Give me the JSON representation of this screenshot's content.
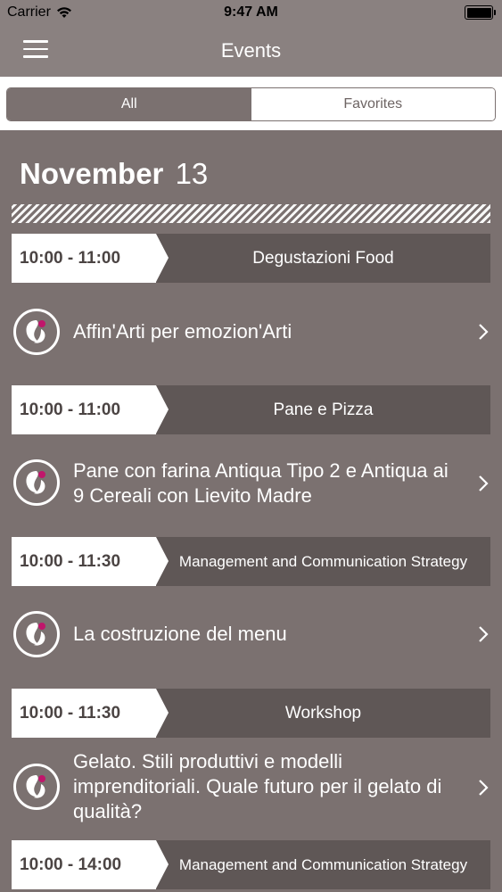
{
  "status_bar": {
    "carrier": "Carrier",
    "time": "9:47 AM"
  },
  "nav": {
    "title": "Events"
  },
  "segments": {
    "all": "All",
    "favorites": "Favorites",
    "selected": "All"
  },
  "date": {
    "month": "November",
    "day": "13"
  },
  "sessions": [
    {
      "time": "10:00 - 11:00",
      "title": "Degustazioni Food"
    },
    {
      "time": "10:00 - 11:00",
      "title": "Pane e Pizza"
    },
    {
      "time": "10:00 - 11:30",
      "title": "Management and Communication Strategy"
    },
    {
      "time": "10:00 - 11:30",
      "title": "Workshop"
    },
    {
      "time": "10:00 - 14:00",
      "title": "Management and Communication Strategy"
    }
  ],
  "events": [
    {
      "title": "Affin'Arti per emozion'Arti"
    },
    {
      "title": "Pane con farina Antiqua Tipo 2 e Antiqua ai 9 Cereali con Lievito Madre"
    },
    {
      "title": "La costruzione del menu"
    },
    {
      "title": "Gelato. Stili produttivi e modelli imprenditoriali. Quale futuro per il gelato di qualità?"
    }
  ],
  "icons": {
    "menu": "hamburger-icon",
    "event_logo": "event-logo-icon",
    "chevron": "chevron-right-icon",
    "wifi": "wifi-icon",
    "battery": "battery-icon"
  },
  "colors": {
    "background": "#7b7170",
    "bar": "#8a8180",
    "session_band": "#5f5756",
    "accent": "#c0166b"
  }
}
